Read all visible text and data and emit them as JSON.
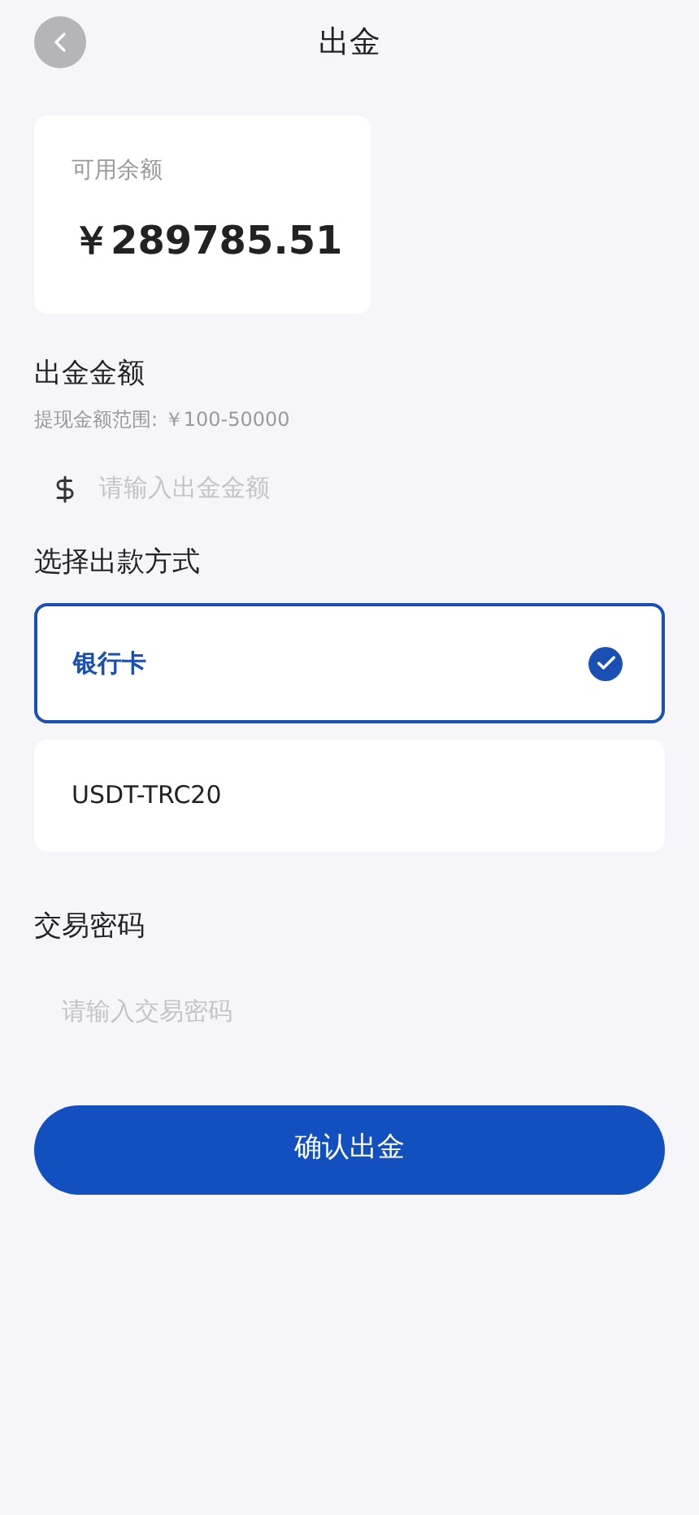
{
  "header": {
    "title": "出金"
  },
  "balance": {
    "label": "可用余额",
    "amount": "￥289785.51"
  },
  "amount": {
    "label": "出金金额",
    "hint": "提现金额范围: ￥100-50000",
    "placeholder": "请输入出金金额"
  },
  "methods": {
    "label": "选择出款方式",
    "options": [
      {
        "label": "银行卡",
        "selected": true
      },
      {
        "label": "USDT-TRC20",
        "selected": false
      }
    ]
  },
  "password": {
    "label": "交易密码",
    "placeholder": "请输入交易密码"
  },
  "submit": {
    "label": "确认出金"
  }
}
